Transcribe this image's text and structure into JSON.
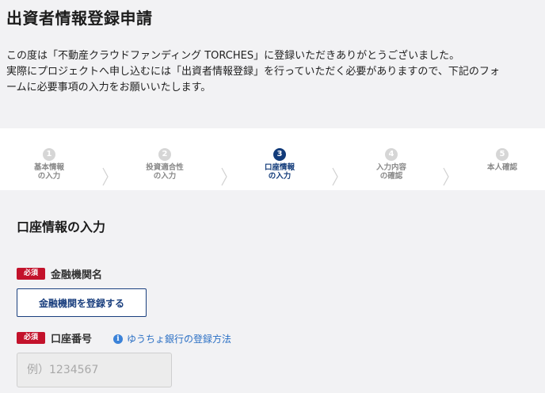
{
  "header": {
    "title": "出資者情報登録申請",
    "intro_line1": "この度は「不動産クラウドファンディング TORCHES」に登録いただきありがとうございました。",
    "intro_line2": "実際にプロジェクトへ申し込むには「出資者情報登録」を行っていただく必要がありますので、下記のフォ",
    "intro_line3": "ームに必要事項の入力をお願いいたします。"
  },
  "stepper": {
    "active_step": 3,
    "steps": [
      {
        "num": "1",
        "line1": "基本情報",
        "line2": "の入力"
      },
      {
        "num": "2",
        "line1": "投資適合性",
        "line2": "の入力"
      },
      {
        "num": "3",
        "line1": "口座情報",
        "line2": "の入力"
      },
      {
        "num": "4",
        "line1": "入力内容",
        "line2": "の確認"
      },
      {
        "num": "5",
        "line1": "本人確認",
        "line2": ""
      }
    ],
    "colors": {
      "active": "#123b7a",
      "inactive": "#d6d6d6",
      "chevron": "#d0d0d0"
    }
  },
  "form": {
    "section_title": "口座情報の入力",
    "required_badge": "必須",
    "bank": {
      "label": "金融機関名",
      "button_label": "金融機関を登録する"
    },
    "account": {
      "label": "口座番号",
      "help_link": "ゆうちょ銀行の登録方法",
      "placeholder": "例）1234567",
      "value": ""
    }
  },
  "icons": {
    "info": "info-icon",
    "chevron": "chevron-right-icon"
  },
  "colors": {
    "required": "#c3122b",
    "primary": "#1a3f7e",
    "link": "#2a6fc4"
  }
}
